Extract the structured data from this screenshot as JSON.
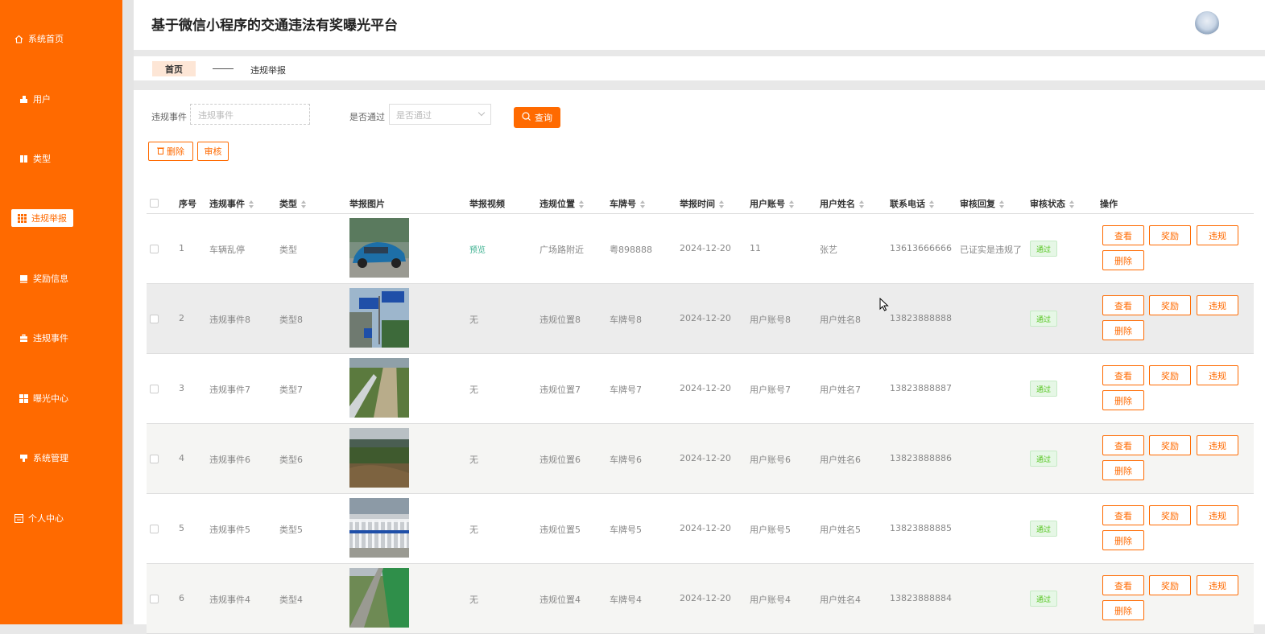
{
  "app": {
    "title": "基于微信小程序的交通违法有奖曝光平台"
  },
  "sidebar": {
    "items": [
      {
        "label": "系统首页",
        "icon": "home-icon"
      },
      {
        "label": "用户",
        "icon": "user-icon"
      },
      {
        "label": "类型",
        "icon": "book-icon"
      },
      {
        "label": "违规举报",
        "icon": "grid-icon",
        "active": true
      },
      {
        "label": "奖励信息",
        "icon": "card-icon"
      },
      {
        "label": "违规事件",
        "icon": "briefcase-icon"
      },
      {
        "label": "曝光中心",
        "icon": "apps-icon"
      },
      {
        "label": "系统管理",
        "icon": "settings-icon"
      },
      {
        "label": "个人中心",
        "icon": "profile-icon"
      }
    ]
  },
  "breadcrumb": {
    "home": "首页",
    "current": "违规举报"
  },
  "filters": {
    "event_label": "违规事件",
    "event_placeholder": "违规事件",
    "pass_label": "是否通过",
    "pass_placeholder": "是否通过",
    "query_label": "查询"
  },
  "toolbar": {
    "delete_label": "删除",
    "audit_label": "审核"
  },
  "table": {
    "columns": [
      "序号",
      "违规事件",
      "类型",
      "举报图片",
      "举报视频",
      "违规位置",
      "车牌号",
      "举报时间",
      "用户账号",
      "用户姓名",
      "联系电话",
      "审核回复",
      "审核状态",
      "操作"
    ],
    "actions": {
      "view": "查看",
      "reward": "奖励",
      "violation": "违规",
      "delete": "删除"
    },
    "rows": [
      {
        "no": "1",
        "event": "车辆乱停",
        "type": "类型",
        "video": "预览",
        "location": "广场路附近",
        "plate": "粤898888",
        "time": "2024-12-20",
        "account": "11",
        "name": "张艺",
        "phone": "13613666666",
        "reply": "已证实是违规了",
        "status": "通过",
        "photo": "car"
      },
      {
        "no": "2",
        "event": "违规事件8",
        "type": "类型8",
        "video": "无",
        "location": "违规位置8",
        "plate": "车牌号8",
        "time": "2024-12-20",
        "account": "用户账号8",
        "name": "用户姓名8",
        "phone": "13823888888",
        "reply": "",
        "status": "通过",
        "photo": "signs"
      },
      {
        "no": "3",
        "event": "违规事件7",
        "type": "类型7",
        "video": "无",
        "location": "违规位置7",
        "plate": "车牌号7",
        "time": "2024-12-20",
        "account": "用户账号7",
        "name": "用户姓名7",
        "phone": "13823888887",
        "reply": "",
        "status": "通过",
        "photo": "path"
      },
      {
        "no": "4",
        "event": "违规事件6",
        "type": "类型6",
        "video": "无",
        "location": "违规位置6",
        "plate": "车牌号6",
        "time": "2024-12-20",
        "account": "用户账号6",
        "name": "用户姓名6",
        "phone": "13823888886",
        "reply": "",
        "status": "通过",
        "photo": "dirt"
      },
      {
        "no": "5",
        "event": "违规事件5",
        "type": "类型5",
        "video": "无",
        "location": "违规位置5",
        "plate": "车牌号5",
        "time": "2024-12-20",
        "account": "用户账号5",
        "name": "用户姓名5",
        "phone": "13823888885",
        "reply": "",
        "status": "通过",
        "photo": "fence"
      },
      {
        "no": "6",
        "event": "违规事件4",
        "type": "类型4",
        "video": "无",
        "location": "违规位置4",
        "plate": "车牌号4",
        "time": "2024-12-20",
        "account": "用户账号4",
        "name": "用户姓名4",
        "phone": "13823888884",
        "reply": "",
        "status": "通过",
        "photo": "rail"
      }
    ]
  },
  "colors": {
    "accent": "#ff6a00",
    "pass_green": "#52c41a",
    "preview_teal": "#3bb08f"
  }
}
